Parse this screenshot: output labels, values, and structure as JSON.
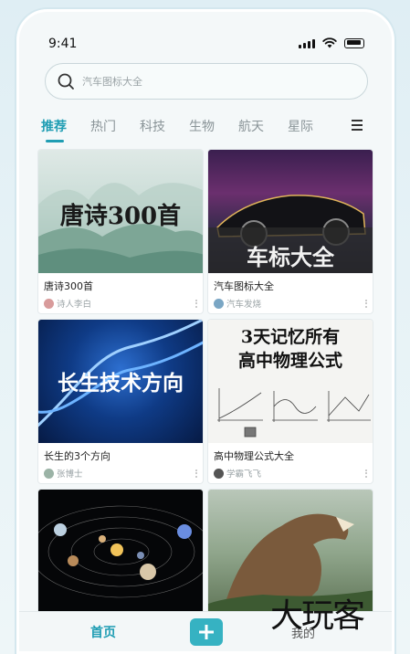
{
  "status": {
    "time": "9:41"
  },
  "search": {
    "placeholder": "汽车图标大全"
  },
  "tabs": [
    {
      "label": "推荐",
      "active": true
    },
    {
      "label": "热门"
    },
    {
      "label": "科技"
    },
    {
      "label": "生物"
    },
    {
      "label": "航天"
    },
    {
      "label": "星际"
    }
  ],
  "cards": [
    {
      "image_text": "唐诗300首",
      "title": "唐诗300首",
      "author": "诗人李白"
    },
    {
      "image_text": "车标大全",
      "title": "汽车图标大全",
      "author": "汽车发烧"
    },
    {
      "image_text": "长生技术方向",
      "title": "长生的3个方向",
      "author": "张博士"
    },
    {
      "image_text_line1": "3天记忆所有",
      "image_text_line2": "高中物理公式",
      "title": "高中物理公式大全",
      "author": "学霸飞飞"
    },
    {
      "title": ""
    },
    {
      "title": ""
    }
  ],
  "bottom_nav": {
    "home": "首页",
    "mine": "我的"
  },
  "watermark": "大玩客",
  "colors": {
    "accent": "#1f9db3",
    "add_button": "#36b2c2"
  }
}
